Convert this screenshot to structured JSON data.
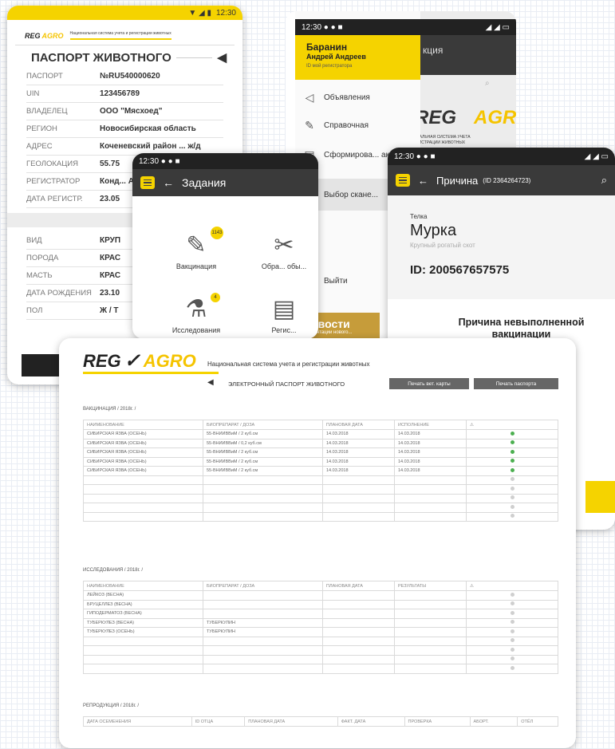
{
  "colors": {
    "brand_yellow": "#f5d300",
    "ok_green": "#4caf50",
    "grey_dot": "#cfcfcf"
  },
  "passport": {
    "status_time": "12:30",
    "logo": {
      "reg": "REG",
      "agro": "AGRO"
    },
    "tagline": "Национальная система учета и регистрации животных",
    "title": "ПАСПОРТ ЖИВОТНОГО",
    "back_icon": "arrow-left-icon",
    "rows": [
      {
        "k": "ПАСПОРТ",
        "v": "№RU540000620"
      },
      {
        "k": "UIN",
        "v": "123456789"
      },
      {
        "k": "ВЛАДЕЛЕЦ",
        "v": "ООО \"Мясхоед\""
      },
      {
        "k": "РЕГИОН",
        "v": "Новосибирская область"
      },
      {
        "k": "АДРЕС",
        "v": "Коченевский район ... ж/д"
      },
      {
        "k": "ГЕОЛОКАЦИЯ",
        "v": "55.75"
      },
      {
        "k": "РЕГИСТРАТОР",
        "v": "Конд... Алекс..."
      },
      {
        "k": "ДАТА РЕГИСТР.",
        "v": "23.05"
      }
    ],
    "rows2": [
      {
        "k": "ВИД",
        "v": "КРУП"
      },
      {
        "k": "ПОРОДА",
        "v": "КРАС"
      },
      {
        "k": "МАСТЬ",
        "v": "КРАС"
      },
      {
        "k": "ДАТА РОЖДЕНИЯ",
        "v": "23.10"
      },
      {
        "k": "ПОЛ",
        "v": "Ж / Т"
      }
    ]
  },
  "tasks": {
    "status_time": "12:30",
    "title": "Задания",
    "items": [
      {
        "label": "Вакцинация",
        "badge": "1143",
        "icon": "syringe-icon"
      },
      {
        "label": "Обра... обы...",
        "badge": "",
        "icon": "spray-icon"
      },
      {
        "label": "Исследования",
        "badge": "4",
        "icon": "microscope-icon"
      },
      {
        "label": "Регис...",
        "badge": "",
        "icon": "clipboard-icon"
      }
    ]
  },
  "menu": {
    "status_time": "12:30",
    "user_last": "Баранин",
    "user_first": "Андрей Андреев",
    "user_sub": "ID мой регистратора",
    "bg_title": "кция",
    "bg_tagline_1": "НАЛЬНАЯ СИСТЕМА УЧЕТА",
    "bg_tagline_2": "ГИСТРАЦИИ ЖИВОТНЫХ",
    "items": [
      {
        "label": "Объявления",
        "icon": "megaphone-icon"
      },
      {
        "label": "Справочная",
        "icon": "book-icon"
      },
      {
        "label": "Сформирова... акты",
        "icon": "document-icon"
      },
      {
        "label": "Выбор скане...",
        "icon": "checkbox-icon"
      }
    ],
    "logout": "Выйти",
    "news_title": "Новости",
    "news_sub": "Презентации нового..."
  },
  "reason": {
    "status_time": "12:30",
    "title": "Причина",
    "id_small": "(ID 2364264723)",
    "kind": "Телка",
    "name": "Мурка",
    "type": "Крупный рогатый скот",
    "id_label": "ID:",
    "id_value": "200567657575",
    "heading_1": "Причина невыполненной",
    "heading_2": "вакцинации"
  },
  "main": {
    "system_title": "Национальная система учета и регистрации животных",
    "passport_title": "ЭЛЕКТРОННЫЙ ПАСПОРТ ЖИВОТНОГО",
    "btn_vet": "Печать вет. карты",
    "btn_passport": "Печать паспорта",
    "vac": {
      "title": "ВАКЦИНАЦИЯ / 2018г. /",
      "headers": [
        "НАИМЕНОВАНИЕ",
        "БИОПРЕПАРАТ / ДОЗА",
        "ПЛАНОВАЯ ДАТА",
        "ИСПОЛНЕНИЕ",
        "⚠"
      ],
      "rows": [
        [
          "СИБИРСКАЯ ЯЗВА (ОСЕНЬ)",
          "55-ВНИИВВиМ / 2 куб.см",
          "14.03.2018",
          "14.03.2018",
          "green"
        ],
        [
          "СИБИРСКАЯ ЯЗВА (ОСЕНЬ)",
          "55-ВНИИВВиМ / 0,2 куб.см",
          "14.03.2018",
          "14.03.2018",
          "green"
        ],
        [
          "СИБИРСКАЯ ЯЗВА (ОСЕНЬ)",
          "55-ВНИИВВиМ / 2 куб.см",
          "14.03.2018",
          "14.03.2018",
          "green"
        ],
        [
          "СИБИРСКАЯ ЯЗВА (ОСЕНЬ)",
          "55-ВНИИВВиМ / 2 куб.см",
          "14.03.2018",
          "14.03.2018",
          "green"
        ],
        [
          "СИБИРСКАЯ ЯЗВА (ОСЕНЬ)",
          "55-ВНИИВВиМ / 2 куб.см",
          "14.03.2018",
          "14.03.2018",
          "green"
        ],
        [
          "",
          "",
          "",
          "",
          "grey"
        ],
        [
          "",
          "",
          "",
          "",
          "grey"
        ],
        [
          "",
          "",
          "",
          "",
          "grey"
        ],
        [
          "",
          "",
          "",
          "",
          "grey"
        ],
        [
          "",
          "",
          "",
          "",
          "grey"
        ]
      ]
    },
    "res": {
      "title": "ИССЛЕДОВАНИЯ / 2018г. /",
      "headers": [
        "НАИМЕНОВАНИЕ",
        "БИОПРЕПАРАТ / ДОЗА",
        "ПЛАНОВАЯ ДАТА",
        "РЕЗУЛЬТАТЫ",
        "⚠"
      ],
      "rows": [
        [
          "ЛЕЙКОЗ (ВЕСНА)",
          "",
          "",
          "",
          "grey"
        ],
        [
          "БРУЦЕЛЛЕЗ (ВЕСНА)",
          "",
          "",
          "",
          "grey"
        ],
        [
          "ГИПОДЕРМАТОЗ (ВЕСНА)",
          "",
          "",
          "",
          "grey"
        ],
        [
          "ТУБЕРКУЛЕЗ (ВЕСНА)",
          "ТУБЕРКУЛИН",
          "",
          "",
          "grey"
        ],
        [
          "ТУБЕРКУЛЕЗ (ОСЕНЬ)",
          "ТУБЕРКУЛИН",
          "",
          "",
          "grey"
        ],
        [
          "",
          "",
          "",
          "",
          "grey"
        ],
        [
          "",
          "",
          "",
          "",
          "grey"
        ],
        [
          "",
          "",
          "",
          "",
          "grey"
        ],
        [
          "",
          "",
          "",
          "",
          "grey"
        ]
      ]
    },
    "rep": {
      "title": "РЕПРОДУКЦИЯ / 2018г. /",
      "headers": [
        "ДАТА ОСЕМЕНЕНИЯ",
        "ID ОТЦА",
        "ПЛАНОВАЯ ДАТА",
        "ФАКТ. ДАТА",
        "ПРОВЕРКА",
        "АБОРТ.",
        "ОТЁЛ"
      ]
    }
  }
}
